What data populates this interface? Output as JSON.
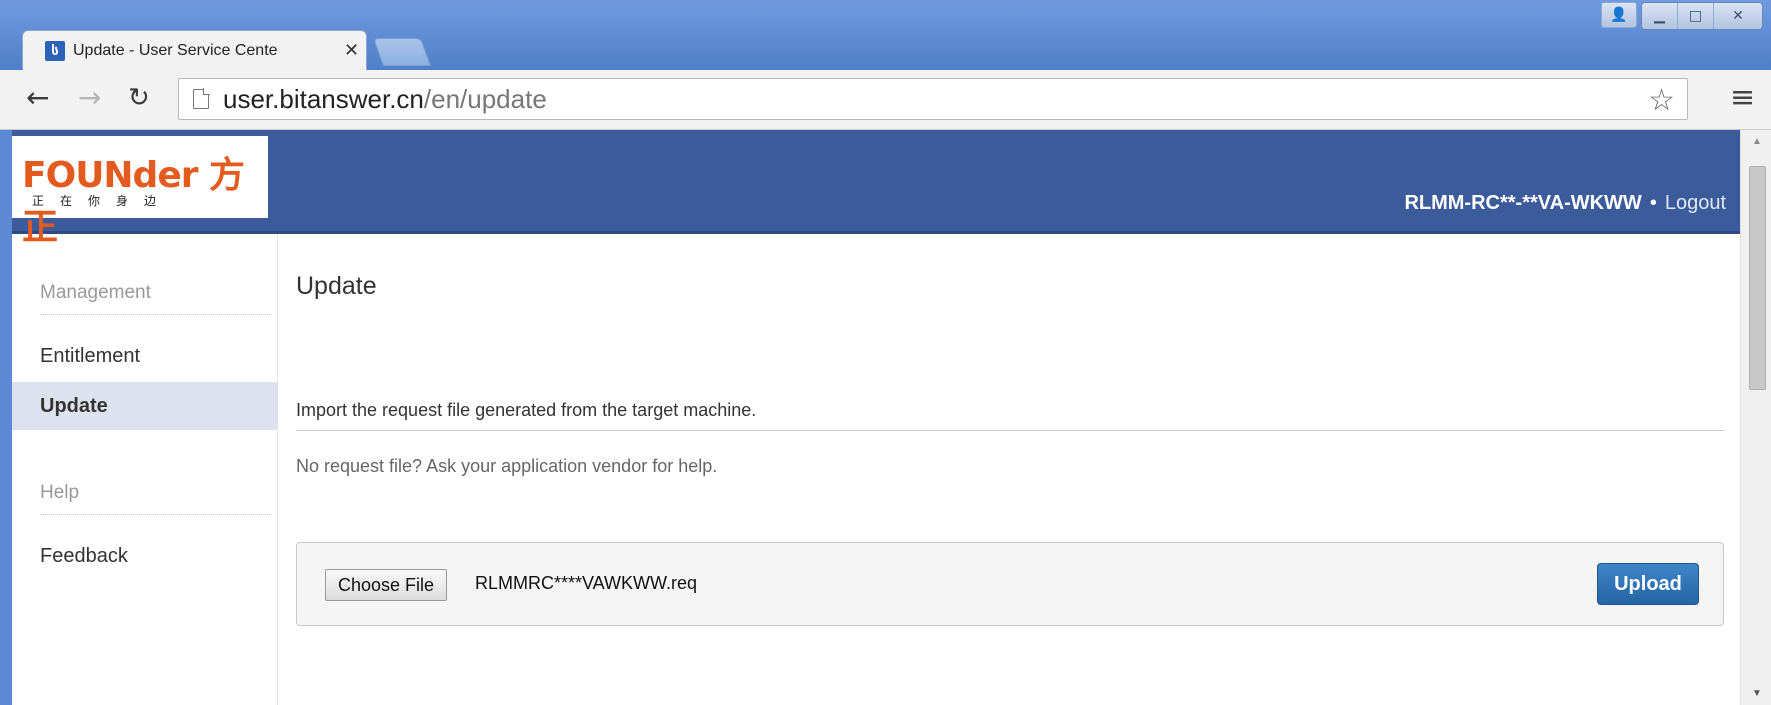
{
  "browser": {
    "tab_title": "Update - User Service Cente",
    "tab_close": "✕",
    "url_host": "user.bitanswer.cn",
    "url_path": "/en/update"
  },
  "header": {
    "logo_text": "FOUNder 方正",
    "logo_tagline": "正在你身边",
    "user_id": "RLMM-RC**-**VA-WKWW",
    "separator": "•",
    "logout": "Logout"
  },
  "sidebar": {
    "management_heading": "Management",
    "items_management": [
      "Entitlement",
      "Update"
    ],
    "help_heading": "Help",
    "items_help": [
      "Feedback"
    ]
  },
  "main": {
    "title": "Update",
    "instruction": "Import the request file generated from the target machine.",
    "help_text": "No request file? Ask your application vendor for help.",
    "choose_file_label": "Choose File",
    "file_name": "RLMMRC****VAWKWW.req",
    "upload_label": "Upload"
  }
}
